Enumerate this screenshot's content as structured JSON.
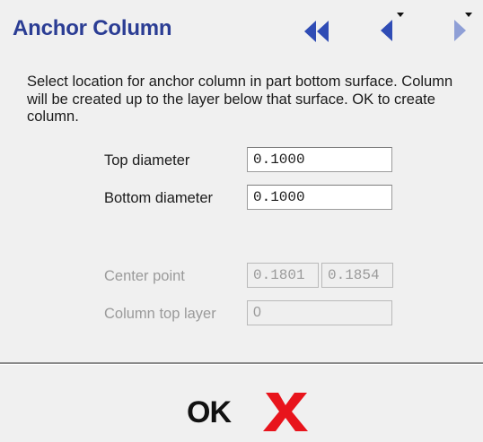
{
  "dialog": {
    "title": "Anchor Column",
    "instructions": "Select location for anchor column in part bottom surface. Column will be created up to the layer below that surface. OK to create column."
  },
  "fields": {
    "top_diameter": {
      "label": "Top diameter",
      "value": "0.1000"
    },
    "bottom_diameter": {
      "label": "Bottom diameter",
      "value": "0.1000"
    },
    "center_point": {
      "label": "Center point",
      "x": "0.1801",
      "y": "0.1854"
    },
    "column_top_layer": {
      "label": "Column top layer",
      "value": "0"
    }
  },
  "footer": {
    "ok_label": "OK",
    "cancel_icon": "red-x-icon"
  },
  "colors": {
    "title": "#2b3d94",
    "nav_arrows": "#2f4cb5",
    "cancel_x": "#e8141c",
    "disabled_text": "#9a9a9a"
  },
  "icons": {
    "nav_first": "double-left-arrow-icon",
    "nav_prev": "left-arrow-icon",
    "nav_next": "right-arrow-icon"
  }
}
